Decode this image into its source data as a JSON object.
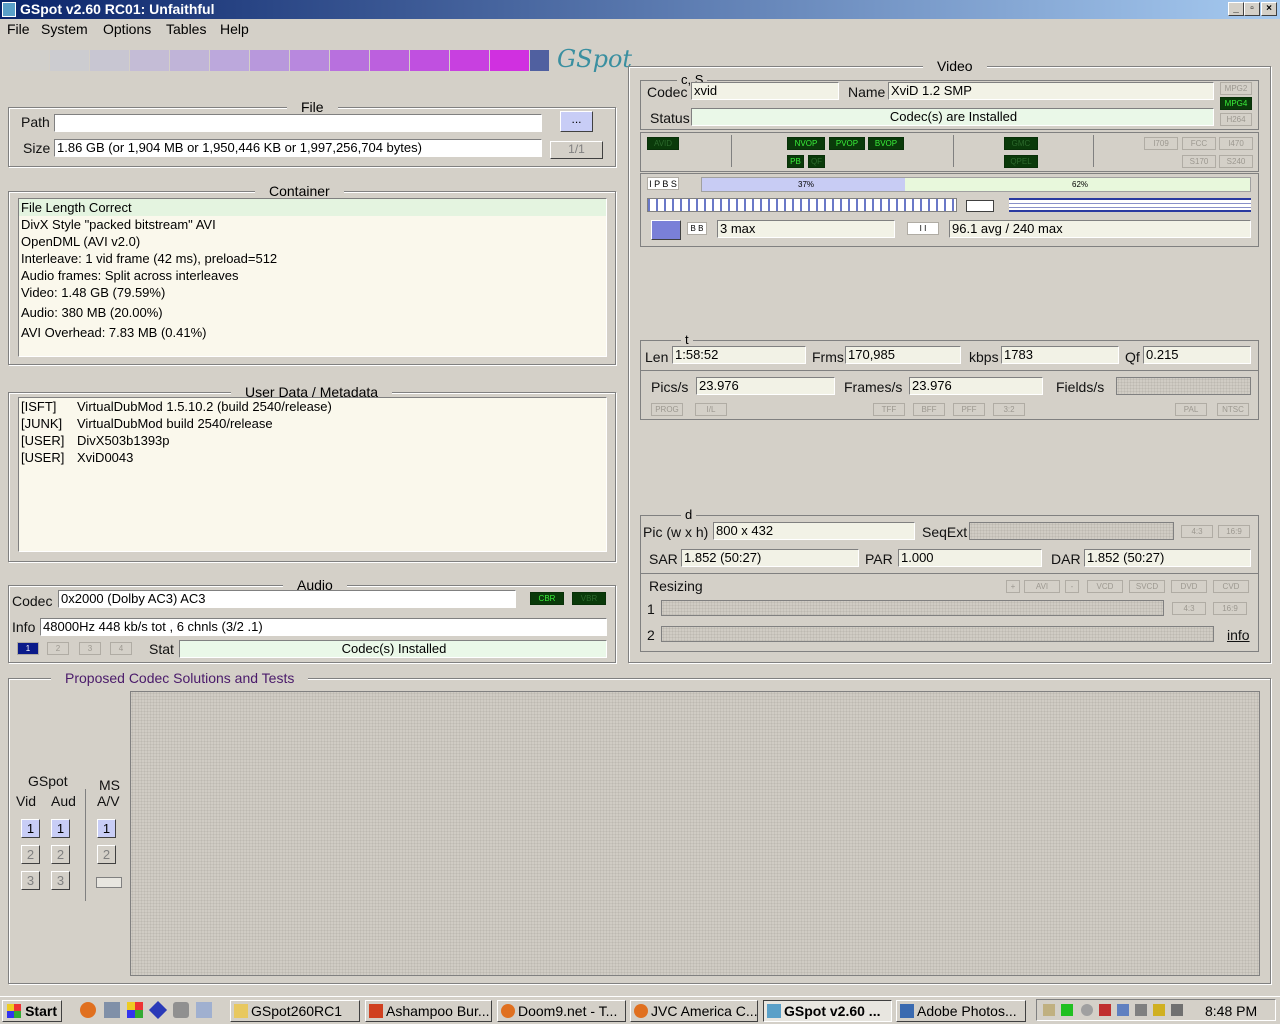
{
  "window": {
    "title": "GSpot v2.60 RC01: Unfaithful",
    "min": "_",
    "max": "▫",
    "close": "×"
  },
  "menu": [
    "File",
    "System",
    "Options",
    "Tables",
    "Help"
  ],
  "logo": "GSpot",
  "file": {
    "title": "File",
    "path_label": "Path",
    "path_value": "",
    "browse_label": "...",
    "size_label": "Size",
    "size_value": "1.86 GB (or 1,904 MB or 1,950,446 KB or 1,997,256,704 bytes)",
    "page": "1/1"
  },
  "container": {
    "title": "Container",
    "lines": [
      "File Length Correct",
      "DivX Style \"packed bitstream\" AVI",
      "OpenDML (AVI v2.0)",
      "Interleave: 1 vid frame (42 ms), preload=512",
      "Audio frames: Split across interleaves",
      "Video: 1.48 GB (79.59%)",
      "Audio: 380 MB (20.00%)",
      "AVI Overhead: 7.83 MB (0.41%)"
    ]
  },
  "userdata": {
    "title": "User Data / Metadata",
    "rows": [
      {
        "tag": "[ISFT]",
        "value": "VirtualDubMod 1.5.10.2 (build 2540/release)"
      },
      {
        "tag": "[JUNK]",
        "value": "VirtualDubMod build 2540/release"
      },
      {
        "tag": "[USER]",
        "value": "DivX503b1393p"
      },
      {
        "tag": "[USER]",
        "value": "XviD0043"
      }
    ]
  },
  "audio": {
    "title": "Audio",
    "codec_label": "Codec",
    "codec_value": "0x2000 (Dolby AC3) AC3",
    "cbr": "CBR",
    "vbr": "VBR",
    "info_label": "Info",
    "info_value": "48000Hz  448 kb/s tot , 6 chnls (3/2 .1)",
    "streams": [
      "1",
      "2",
      "3",
      "4"
    ],
    "stat_label": "Stat",
    "stat_value": "Codec(s) Installed"
  },
  "video": {
    "title": "Video",
    "cs_label": "c, S",
    "codec_label": "Codec",
    "codec_value": "xvid",
    "name_label": "Name",
    "name_value": "XviD 1.2 SMP",
    "status_label": "Status",
    "status_value": "Codec(s) are Installed",
    "side_tags": [
      "MPG2",
      "MPG4",
      "H264"
    ],
    "flags_left": [
      "AVID"
    ],
    "flags_mid": [
      "NVOP",
      "PVOP",
      "BVOP",
      "PB",
      "QF"
    ],
    "flags_gmc": [
      "GMC",
      "QPEL"
    ],
    "flags_right": [
      "I709",
      "FCC",
      "I470",
      "S170",
      "S240"
    ],
    "frame_types": "I P B S",
    "pct_left": "37%",
    "pct_right": "62%",
    "pct_left_value": 37,
    "b_label": "B B",
    "b_value": "3 max",
    "rate_value": "96.1 avg / 240 max",
    "t_label": "t",
    "len_label": "Len",
    "len_value": "1:58:52",
    "frms_label": "Frms",
    "frms_value": "170,985",
    "kbps_label": "kbps",
    "kbps_value": "1783",
    "qf_label": "Qf",
    "qf_value": "0.215",
    "pics_label": "Pics/s",
    "pics_value": "23.976",
    "frames_label": "Frames/s",
    "frames_value": "23.976",
    "fields_label": "Fields/s",
    "scan_tags": [
      "PROG",
      "I/L",
      "TFF",
      "BFF",
      "PFF",
      "3:2",
      "PAL",
      "NTSC"
    ],
    "d_label": "d",
    "pic_label": "Pic (w x h)",
    "pic_value": "800 x 432",
    "seqext_label": "SeqExt",
    "ar_tags": [
      "4:3",
      "16:9"
    ],
    "sar_label": "SAR",
    "sar_value": "1.852 (50:27)",
    "par_label": "PAR",
    "par_value": "1.000",
    "dar_label": "DAR",
    "dar_value": "1.852 (50:27)",
    "resizing_label": "Resizing",
    "resize_buttons": [
      "+",
      "AVI",
      "-",
      "VCD",
      "SVCD",
      "DVD",
      "CVD"
    ],
    "row1": "1",
    "row2": "2",
    "info_link": "info"
  },
  "proposed": {
    "title": "Proposed Codec Solutions and Tests",
    "gspot_label": "GSpot",
    "vid_label": "Vid",
    "aud_label": "Aud",
    "ms_label": "MS",
    "av_label": "A/V",
    "nums": [
      "1",
      "2",
      "3"
    ]
  },
  "taskbar": {
    "start": "Start",
    "tasks": [
      "GSpot260RC1",
      "Ashampoo Bur...",
      "Doom9.net - T...",
      "JVC America C...",
      "GSpot v2.60 ...",
      "Adobe Photos..."
    ],
    "active_index": 4,
    "clock": "8:48 PM"
  }
}
